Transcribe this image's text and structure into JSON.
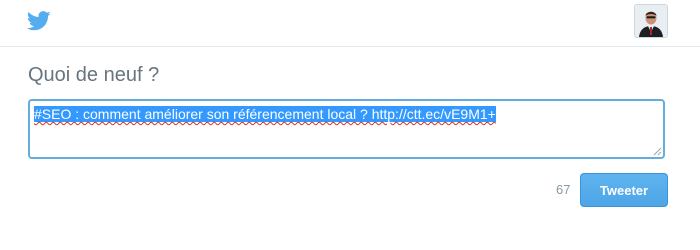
{
  "header": {
    "logo_icon": "twitter-bird-icon",
    "avatar_icon": "user-avatar",
    "brand_color": "#55acee"
  },
  "composer": {
    "heading": "Quoi de neuf ?",
    "text": "#SEO : comment améliorer son référencement local ? http://ctt.ec/vE9M1+",
    "focus_color": "#64aede"
  },
  "footer": {
    "char_count": "67",
    "tweet_button_label": "Tweeter"
  }
}
